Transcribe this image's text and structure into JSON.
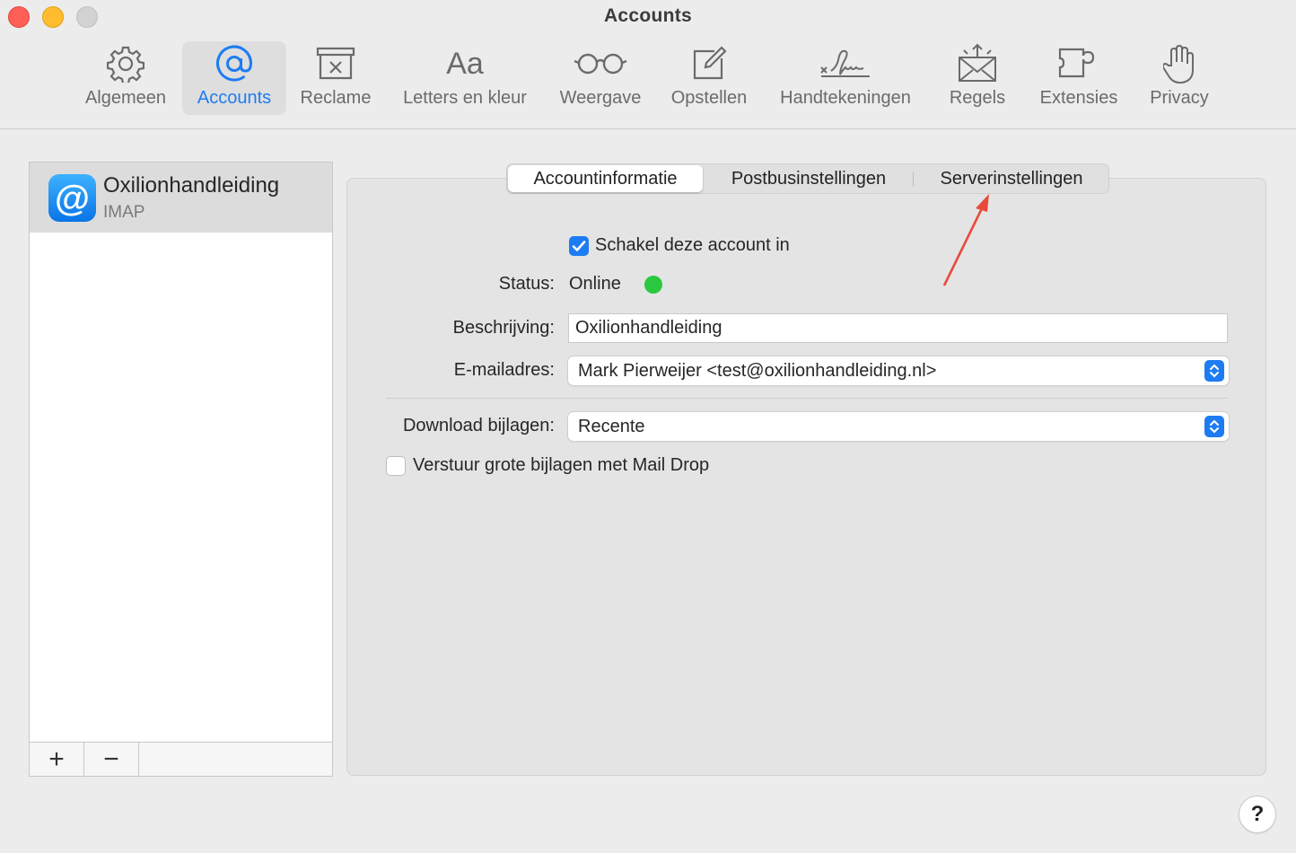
{
  "window": {
    "title": "Accounts"
  },
  "toolbar": {
    "items": [
      {
        "label": "Algemeen",
        "icon": "gear-icon"
      },
      {
        "label": "Accounts",
        "icon": "at-icon",
        "active": true
      },
      {
        "label": "Reclame",
        "icon": "junk-bin-icon"
      },
      {
        "label": "Letters en kleur",
        "icon": "fonts-icon"
      },
      {
        "label": "Weergave",
        "icon": "glasses-icon"
      },
      {
        "label": "Opstellen",
        "icon": "compose-icon"
      },
      {
        "label": "Handtekeningen",
        "icon": "signature-icon"
      },
      {
        "label": "Regels",
        "icon": "rules-envelope-icon"
      },
      {
        "label": "Extensies",
        "icon": "puzzle-icon"
      },
      {
        "label": "Privacy",
        "icon": "hand-icon"
      }
    ],
    "fonts_glyph": "Aa"
  },
  "sidebar": {
    "account": {
      "name": "Oxilionhandleiding",
      "type": "IMAP",
      "icon_glyph": "@"
    },
    "add_label": "+",
    "remove_label": "−"
  },
  "tabs": [
    {
      "label": "Accountinformatie",
      "selected": true
    },
    {
      "label": "Postbusinstellingen"
    },
    {
      "label": "Serverinstellingen"
    }
  ],
  "form": {
    "enable_account": {
      "label": "Schakel deze account in",
      "checked": true
    },
    "status": {
      "label": "Status:",
      "value": "Online",
      "color": "#2ac840"
    },
    "description": {
      "label": "Beschrijving:",
      "value": "Oxilionhandleiding"
    },
    "email": {
      "label": "E-mailadres:",
      "value": "Mark Pierweijer <test@oxilionhandleiding.nl>"
    },
    "download": {
      "label": "Download bijlagen:",
      "value": "Recente"
    },
    "mail_drop": {
      "label": "Verstuur grote bijlagen met Mail Drop",
      "checked": false
    }
  },
  "help": {
    "label": "?"
  },
  "colors": {
    "accent": "#1d7cf2",
    "annotation": "#e84a3a"
  }
}
